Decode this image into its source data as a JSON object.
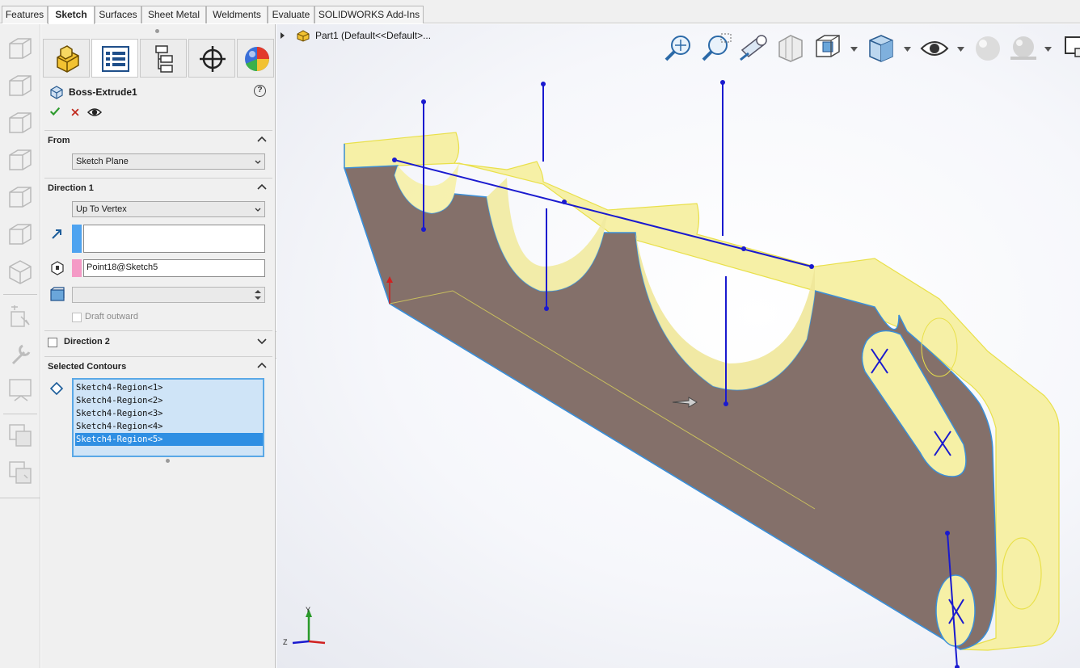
{
  "tabs": [
    "Features",
    "Sketch",
    "Surfaces",
    "Sheet Metal",
    "Weldments",
    "Evaluate",
    "SOLIDWORKS Add-Ins"
  ],
  "active_tab": "Sketch",
  "feature_tree": {
    "part_label": "Part1  (Default<<Default>..."
  },
  "property_manager": {
    "title": "Boss-Extrude1",
    "help": "?",
    "tab_icons": [
      "feature-manager-icon",
      "property-manager-icon",
      "configuration-manager-icon",
      "dimxpert-icon",
      "display-manager-icon"
    ],
    "from": {
      "label": "From",
      "value": "Sketch Plane"
    },
    "direction1": {
      "label": "Direction 1",
      "end_condition": "Up To Vertex",
      "direction_value": "",
      "vertex": "Point18@Sketch5",
      "offset_value": "",
      "draft_outward": "Draft outward"
    },
    "direction2": {
      "label": "Direction 2"
    },
    "selected_contours": {
      "label": "Selected Contours",
      "items": [
        "Sketch4-Region<1>",
        "Sketch4-Region<2>",
        "Sketch4-Region<3>",
        "Sketch4-Region<4>",
        "Sketch4-Region<5>"
      ],
      "selected_index": 4
    }
  },
  "triad": {
    "y": "Y",
    "z": "Z"
  },
  "colors": {
    "accent": "#2f8fe3",
    "face": "#84706a",
    "preview": "#fbf6a8",
    "sketch": "#1a1acf"
  }
}
